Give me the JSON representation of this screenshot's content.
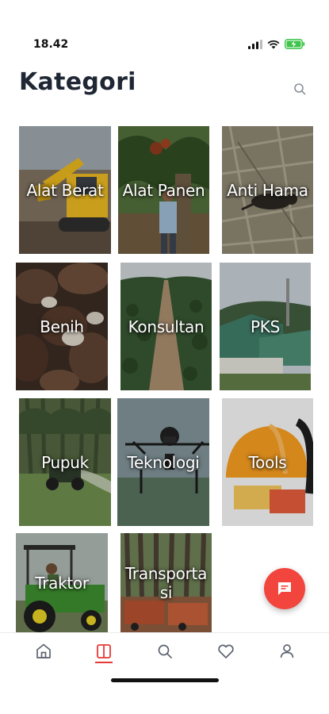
{
  "status_bar": {
    "time": "18.42",
    "signal_icon": "cellular-signal-icon",
    "wifi_icon": "wifi-icon",
    "battery_icon": "battery-charging-icon",
    "battery_color": "#3ec44a"
  },
  "header": {
    "title": "Kategori",
    "search_icon": "search-icon"
  },
  "categories": [
    {
      "label": "Alat Berat"
    },
    {
      "label": "Alat Panen"
    },
    {
      "label": "Anti Hama"
    },
    {
      "label": "Benih"
    },
    {
      "label": "Konsultan"
    },
    {
      "label": "PKS"
    },
    {
      "label": "Pupuk"
    },
    {
      "label": "Teknologi"
    },
    {
      "label": "Tools"
    },
    {
      "label": "Traktor"
    },
    {
      "label": "Transporta\nsi"
    }
  ],
  "fab": {
    "icon": "chat-message-icon",
    "color": "#f1453d"
  },
  "bottom_nav": {
    "items": [
      {
        "icon": "home-icon"
      },
      {
        "icon": "categories-book-icon",
        "active": true
      },
      {
        "icon": "search-icon"
      },
      {
        "icon": "heart-icon"
      },
      {
        "icon": "profile-icon"
      }
    ],
    "active_color": "#e53935",
    "inactive_color": "#5d6470"
  }
}
